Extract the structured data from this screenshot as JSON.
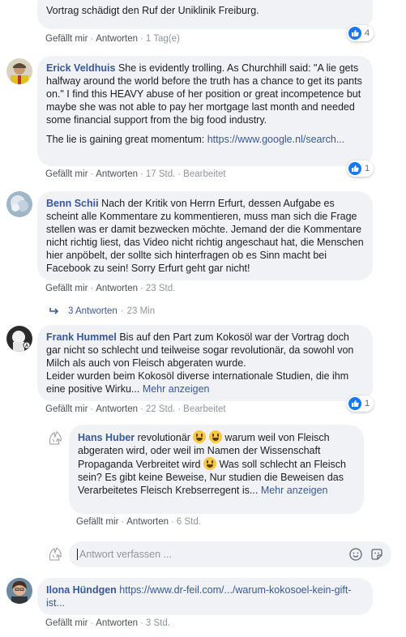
{
  "comments": [
    {
      "id": "c0",
      "tail_text": "Vortrag schädigt den Ruf der Uniklinik Freiburg.",
      "actions": {
        "like": "Gefällt mir",
        "reply": "Antworten",
        "time": "1 Tag(e)"
      },
      "likes": "4"
    },
    {
      "id": "c1",
      "author": "Erick Veldhuis",
      "text": "She is evidently trolling. As Churchhill said: \"A lie gets halfway around the world before the truth has a chance to get its pants on.\" I find this HEAVY abuse of her position or great incompetence but maybe she was not able to pay her mortgage last month and needed some financial support from the big food industry.",
      "text2_prefix": "The lie is gaining great momentum: ",
      "link": "https://www.google.nl/search...",
      "actions": {
        "like": "Gefällt mir",
        "reply": "Antworten",
        "time": "17 Std.",
        "edited": "Bearbeitet"
      },
      "likes": "1"
    },
    {
      "id": "c2",
      "author": "Benn Schii",
      "text": "Nach der Kritik von Herrn Erfurt, dessen Aufgabe es scheint alle Kommentare zu kommentieren, muss man sich die Frage stellen was er damit bezwecken möchte. Jemand der die Kommentare nicht richtig liest, das Video nicht richtig angeschaut hat, die Menschen hier anpöbelt, der sollte sich hinterfragen ob es Sinn macht bei Facebook zu sein! Sorry Erfurt geht gar nicht!",
      "actions": {
        "like": "Gefällt mir",
        "reply": "Antworten",
        "time": "23 Std."
      },
      "replies_label": "3 Antworten",
      "replies_time": "23 Min"
    },
    {
      "id": "c3",
      "author": "Frank Hummel",
      "text": "Bis auf den Part zum Kokosöl war der Vortrag doch gar nicht so schlecht und teilweise sogar revolutionär, da sowohl von Milch als auch von Fleisch abgeraten wurde.",
      "text2": "Leider wurden beim Kokosöl diverse internationale Studien, die ihm eine positive Wirku...",
      "more": "Mehr anzeigen",
      "actions": {
        "like": "Gefällt mir",
        "reply": "Antworten",
        "time": "22 Std.",
        "edited": "Bearbeitet"
      },
      "likes": "1"
    },
    {
      "id": "r1",
      "author": "Hans Huber",
      "text_a": "revolutionär ",
      "text_b": " warum weil von Fleisch abgeraten wird, oder weil im Namen der Wissenschaft Propaganda Verbreitet wird ",
      "text_c": " Was soll schlecht an Fleisch sein? Es gibt keine Beweise, Nur studien die Beweisen das Verarbeitetes Fleisch Krebserregent is...",
      "more": "Mehr anzeigen",
      "actions": {
        "like": "Gefällt mir",
        "reply": "Antworten",
        "time": "6 Std."
      }
    },
    {
      "id": "c4",
      "author": "Ilona Hündgen",
      "link": "https://www.dr-feil.com/.../warum-kokosoel-kein-gift-ist...",
      "actions": {
        "like": "Gefällt mir",
        "reply": "Antworten",
        "time": "3 Std."
      }
    }
  ],
  "reply_input": {
    "placeholder": "Antwort verfassen ..."
  },
  "colors": {
    "link": "#385898",
    "bubble": "#f0f2f5",
    "like_blue": "#1877f2"
  },
  "icons": [
    "thumbs-up-icon",
    "reply-arrow-icon",
    "emoji-icon",
    "sticker-icon"
  ]
}
